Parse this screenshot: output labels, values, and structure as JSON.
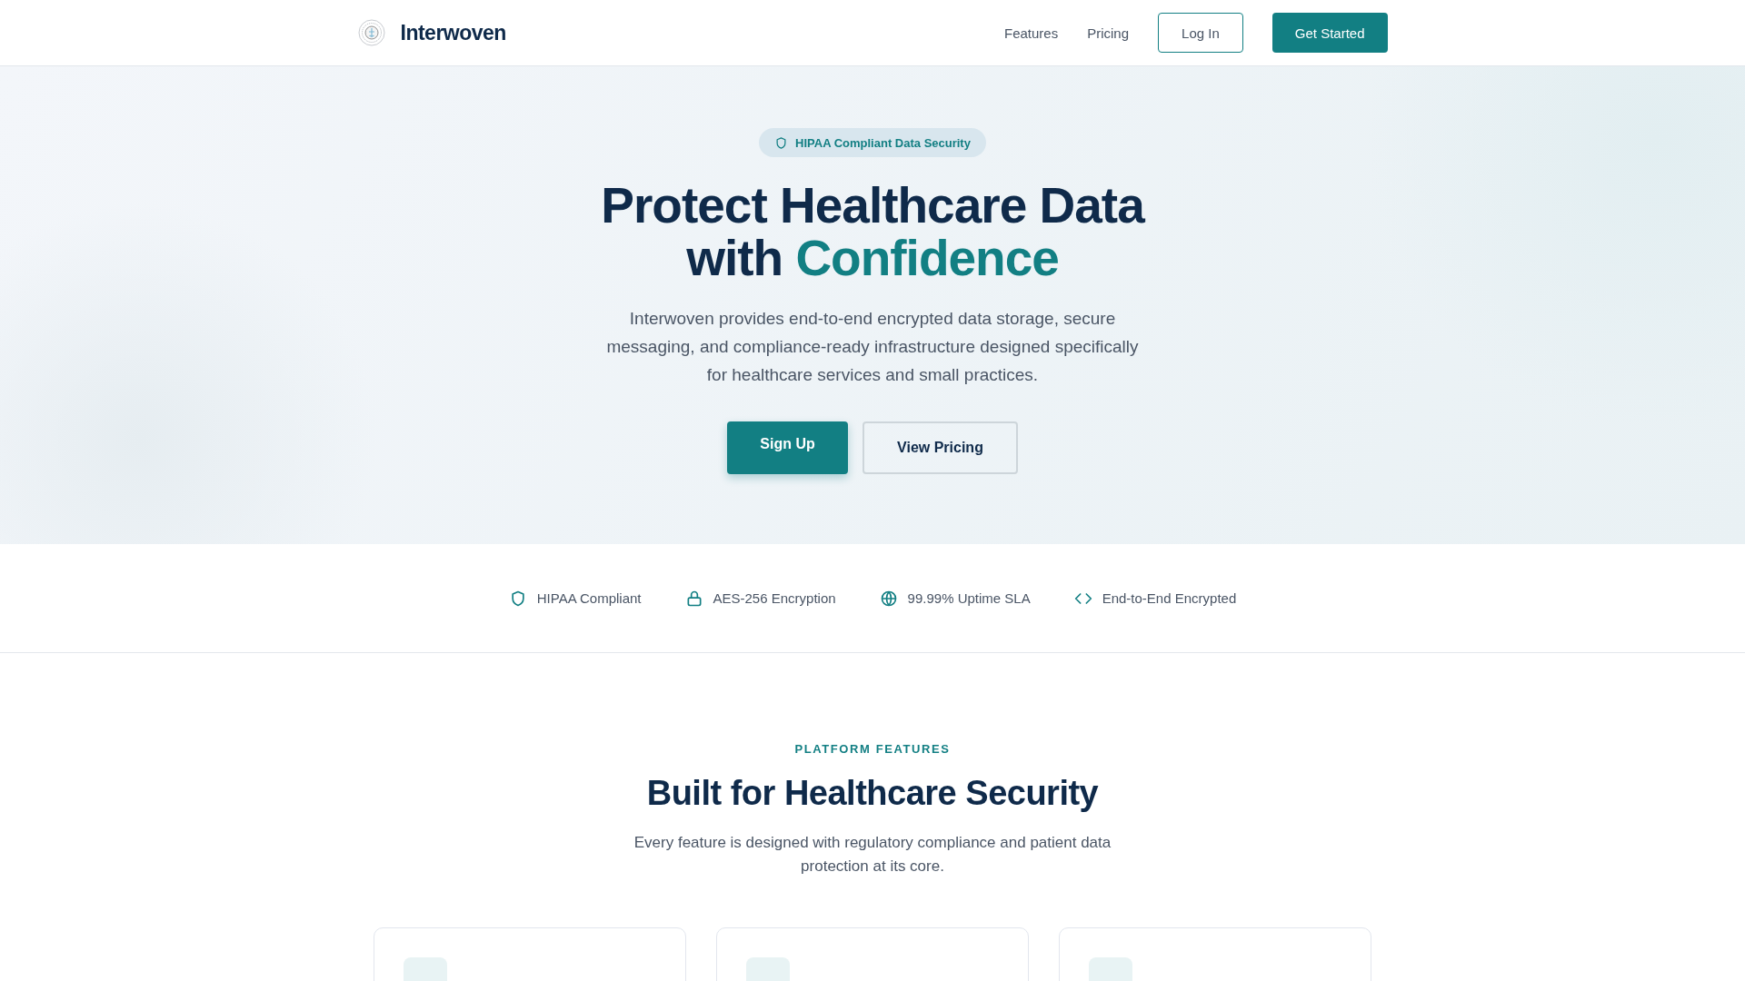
{
  "nav": {
    "brand": "Interwoven",
    "links": [
      "Features",
      "Pricing"
    ],
    "login": "Log In",
    "cta": "Get Started"
  },
  "hero": {
    "badge": "HIPAA Compliant Data Security",
    "title": "Protect Healthcare Data",
    "title_prefix": "with",
    "title_accent": "Confidence",
    "text": "Interwoven provides end-to-end encrypted data storage, secure messaging, and compliance-ready infrastructure designed specifically for healthcare services and small practices.",
    "primary": "Sign Up",
    "secondary": "View Pricing"
  },
  "trust": [
    {
      "kind": "shield",
      "label": "HIPAA Compliant"
    },
    {
      "kind": "lock",
      "label": "AES-256 Encryption"
    },
    {
      "kind": "globe",
      "label": "99.99% Uptime SLA"
    },
    {
      "kind": "code",
      "label": "End-to-End Encrypted"
    }
  ],
  "features": {
    "eyebrow": "PLATFORM FEATURES",
    "title": "Built for Healthcare Security",
    "text": "Every feature is designed with regulatory compliance and patient data protection at its core.",
    "cards": [
      {
        "kind": "card"
      },
      {
        "kind": "card"
      },
      {
        "kind": "card"
      }
    ]
  }
}
